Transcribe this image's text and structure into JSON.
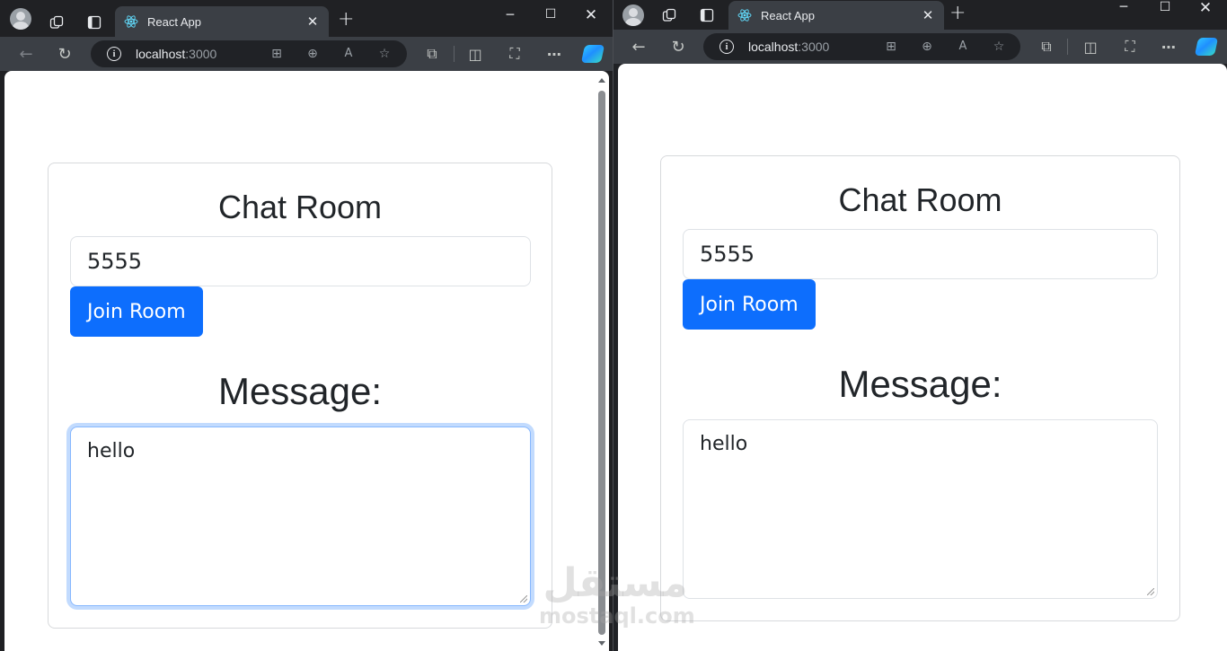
{
  "windows": [
    {
      "tab": {
        "title": "React App"
      },
      "address": {
        "host": "localhost",
        "port": ":3000"
      },
      "page": {
        "title": "Chat Room",
        "room_value": "5555",
        "join_label": "Join Room",
        "message_heading": "Message:",
        "message_value": "hello",
        "message_focused": true
      }
    },
    {
      "tab": {
        "title": "React App"
      },
      "address": {
        "host": "localhost",
        "port": ":3000"
      },
      "page": {
        "title": "Chat Room",
        "room_value": "5555",
        "join_label": "Join Room",
        "message_heading": "Message:",
        "message_value": "hello",
        "message_focused": false
      }
    }
  ],
  "watermark": {
    "arabic": "مستقل",
    "latin": "mostaql.com"
  },
  "colors": {
    "accent": "#0d6efd",
    "focus_ring": "#86b7fe",
    "chrome": "#3b3f45",
    "tabstrip": "#202124"
  },
  "icons": [
    "profile-avatar-icon",
    "workspaces-icon",
    "tab-actions-icon",
    "react-favicon-icon",
    "close-icon",
    "plus-icon",
    "minimize-icon",
    "maximize-icon",
    "back-arrow-icon",
    "refresh-icon",
    "info-icon",
    "app-grid-icon",
    "zoom-icon",
    "read-aloud-icon",
    "favorite-star-icon",
    "extensions-icon",
    "split-screen-icon",
    "screenshot-icon",
    "more-icon",
    "copilot-icon"
  ]
}
